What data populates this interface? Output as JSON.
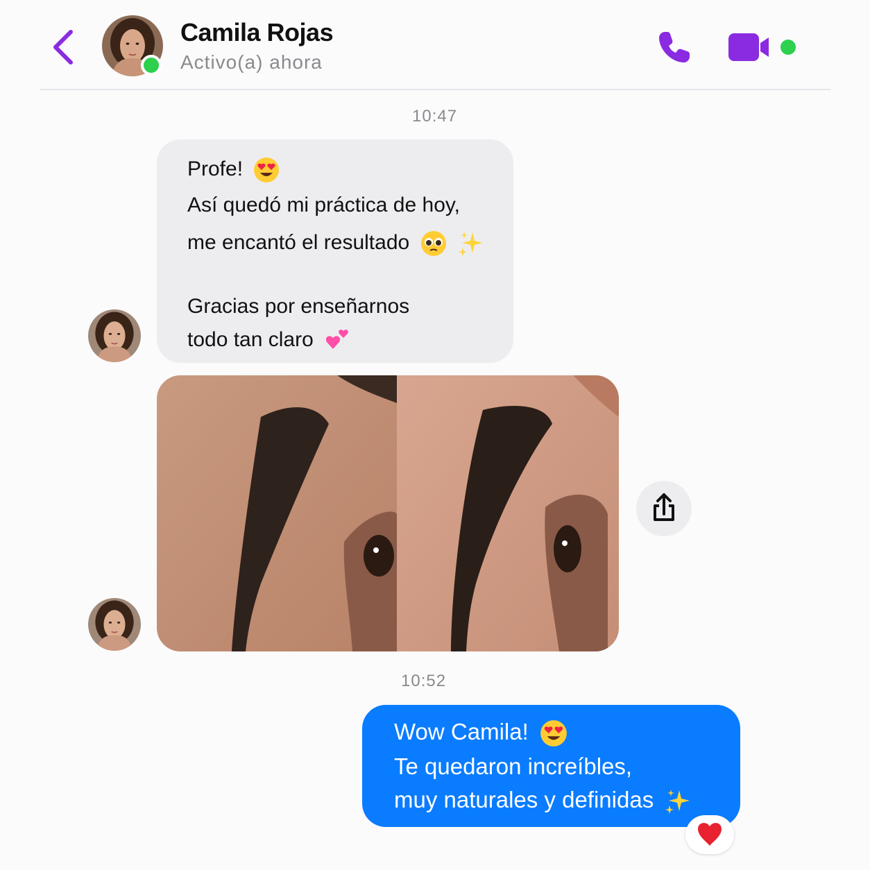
{
  "header": {
    "contact_name": "Camila Rojas",
    "contact_status": "Activo(a) ahora"
  },
  "messages": {
    "time_1": "10:47",
    "incoming": {
      "line_1": "Profe!",
      "line_2": "Así quedó mi práctica de hoy,",
      "line_3": "me encantó el resultado",
      "line_4": "Gracias por enseñarnos",
      "line_5": "todo tan claro"
    },
    "time_2": "10:52",
    "outgoing": {
      "line_1": "Wow Camila!",
      "line_2": "Te quedaron increíbles,",
      "line_3": "muy naturales y definidas"
    }
  },
  "colors": {
    "accent_purple": "#8a2be2",
    "online_green": "#2ed04f",
    "outgoing_blue": "#0a7cff",
    "incoming_gray": "#ededf0"
  },
  "icons": [
    "back-icon",
    "phone-icon",
    "video-camera-icon",
    "share-icon",
    "heart-eyes-emoji",
    "pleading-face-emoji",
    "sparkles-emoji",
    "two-hearts-emoji",
    "red-heart-emoji"
  ]
}
